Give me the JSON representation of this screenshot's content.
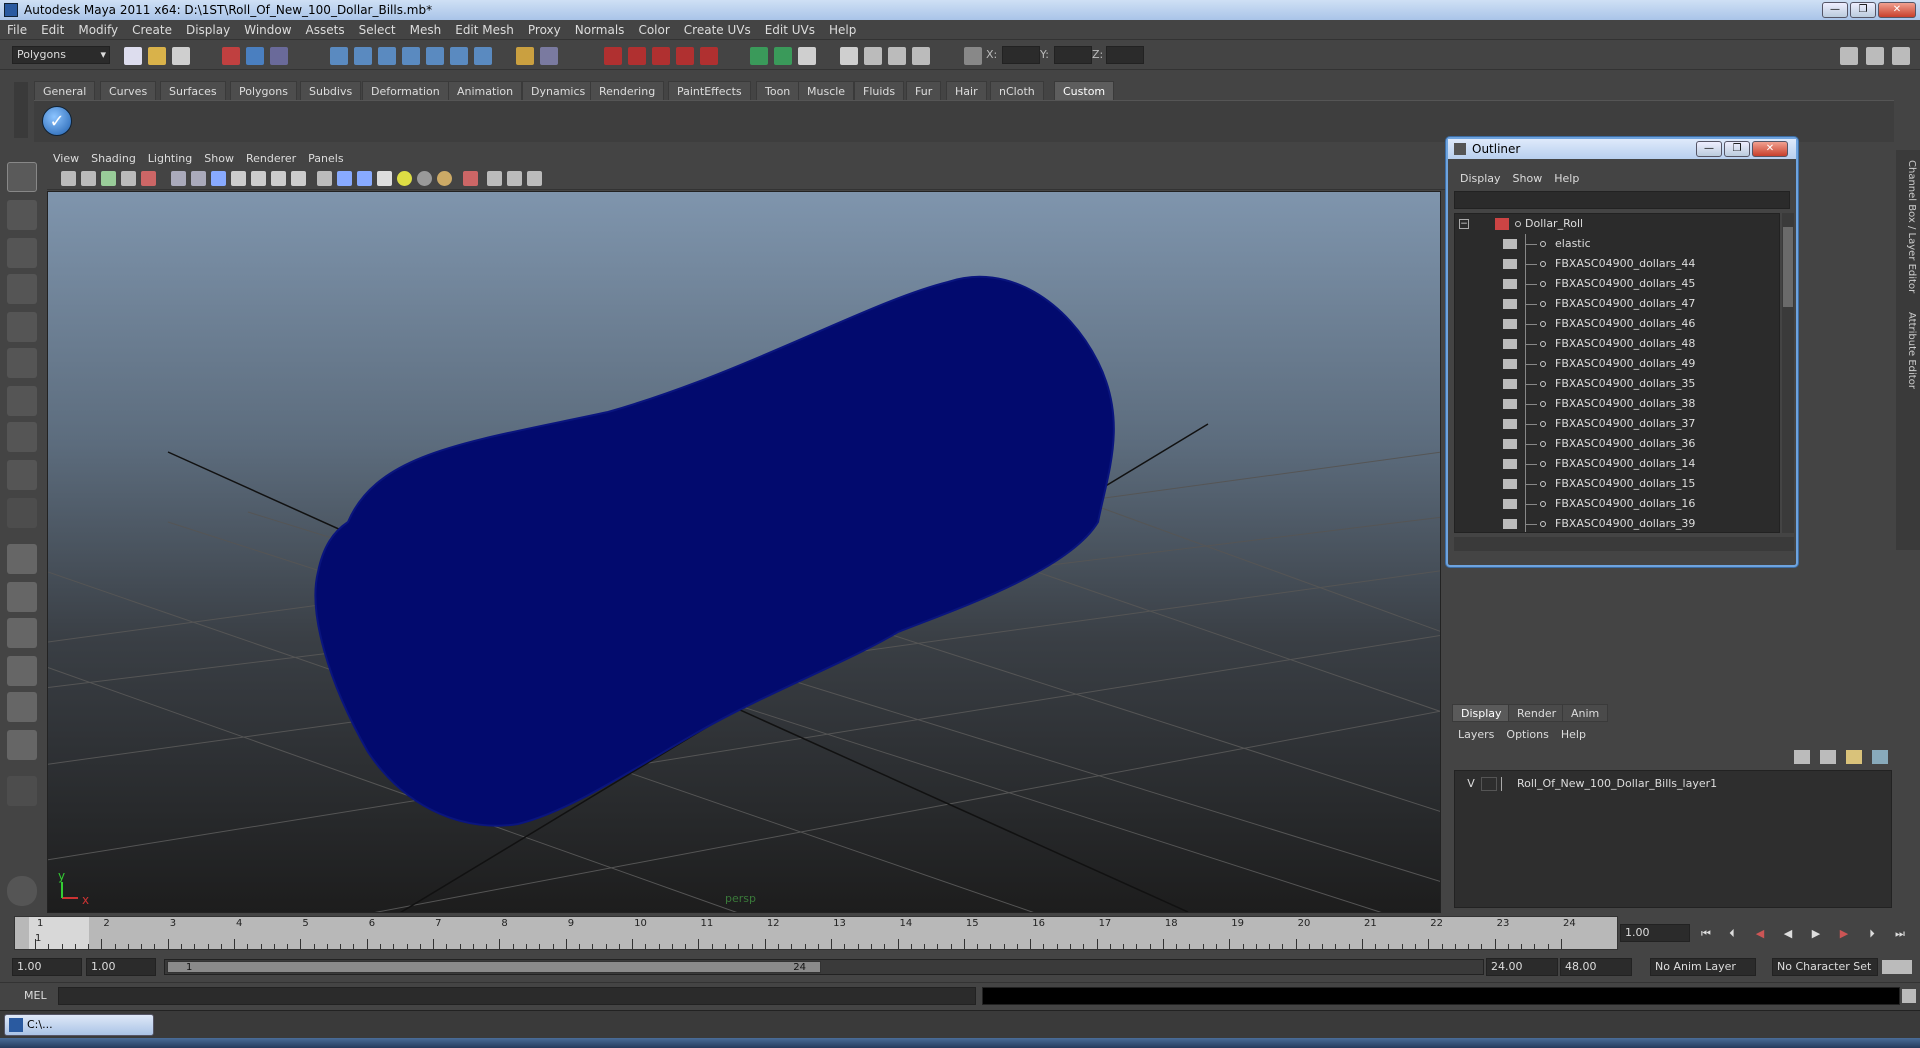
{
  "window": {
    "title": "Autodesk Maya 2011 x64: D:\\1ST\\Roll_Of_New_100_Dollar_Bills.mb*"
  },
  "menubar": [
    "File",
    "Edit",
    "Modify",
    "Create",
    "Display",
    "Window",
    "Assets",
    "Select",
    "Mesh",
    "Edit Mesh",
    "Proxy",
    "Normals",
    "Color",
    "Create UVs",
    "Edit UVs",
    "Help"
  ],
  "statusline": {
    "mode": "Polygons",
    "x_label": "X:",
    "y_label": "Y:",
    "z_label": "Z:"
  },
  "shelf": {
    "tabs": [
      "General",
      "Curves",
      "Surfaces",
      "Polygons",
      "Subdivs",
      "Deformation",
      "Animation",
      "Dynamics",
      "Rendering",
      "PaintEffects",
      "Toon",
      "Muscle",
      "Fluids",
      "Fur",
      "Hair",
      "nCloth",
      "Custom"
    ],
    "active_tab": "Custom"
  },
  "panel": {
    "menu": [
      "View",
      "Shading",
      "Lighting",
      "Show",
      "Renderer",
      "Panels"
    ],
    "camera_label": "persp",
    "axis": {
      "x": "x",
      "y": "y"
    }
  },
  "outliner": {
    "title": "Outliner",
    "menu": [
      "Display",
      "Show",
      "Help"
    ],
    "items": [
      "Dollar_Roll",
      "elastic",
      "FBXASC04900_dollars_44",
      "FBXASC04900_dollars_45",
      "FBXASC04900_dollars_47",
      "FBXASC04900_dollars_46",
      "FBXASC04900_dollars_48",
      "FBXASC04900_dollars_49",
      "FBXASC04900_dollars_35",
      "FBXASC04900_dollars_38",
      "FBXASC04900_dollars_37",
      "FBXASC04900_dollars_36",
      "FBXASC04900_dollars_14",
      "FBXASC04900_dollars_15",
      "FBXASC04900_dollars_16",
      "FBXASC04900_dollars_39"
    ]
  },
  "side_tabs": {
    "channel_box": "Channel Box / Layer Editor",
    "attribute_editor": "Attribute Editor"
  },
  "layer_editor": {
    "tabs": [
      "Display",
      "Render",
      "Anim"
    ],
    "active_tab": "Display",
    "menu": [
      "Layers",
      "Options",
      "Help"
    ],
    "layer": {
      "visibility": "V",
      "name": "Roll_Of_New_100_Dollar_Bills_layer1"
    }
  },
  "time_slider": {
    "ticks": [
      "1",
      "2",
      "3",
      "4",
      "5",
      "6",
      "7",
      "8",
      "9",
      "10",
      "11",
      "12",
      "13",
      "14",
      "15",
      "16",
      "17",
      "18",
      "19",
      "20",
      "21",
      "22",
      "23",
      "24"
    ],
    "current_frame_marker": "1",
    "current_frame": "1.00"
  },
  "range_slider": {
    "start_time": "1.00",
    "playback_start": "1.00",
    "range_handle_start": "1",
    "range_handle_end": "24",
    "playback_end": "24.00",
    "end_time": "48.00",
    "anim_layer": "No Anim Layer",
    "character_set": "No Character Set"
  },
  "command_line": {
    "label": "MEL"
  },
  "taskbar": {
    "item": "C:\\..."
  },
  "colors": {
    "object": "#020a6e",
    "titlebar": "#b8cfee",
    "ui_bg": "#444444"
  }
}
